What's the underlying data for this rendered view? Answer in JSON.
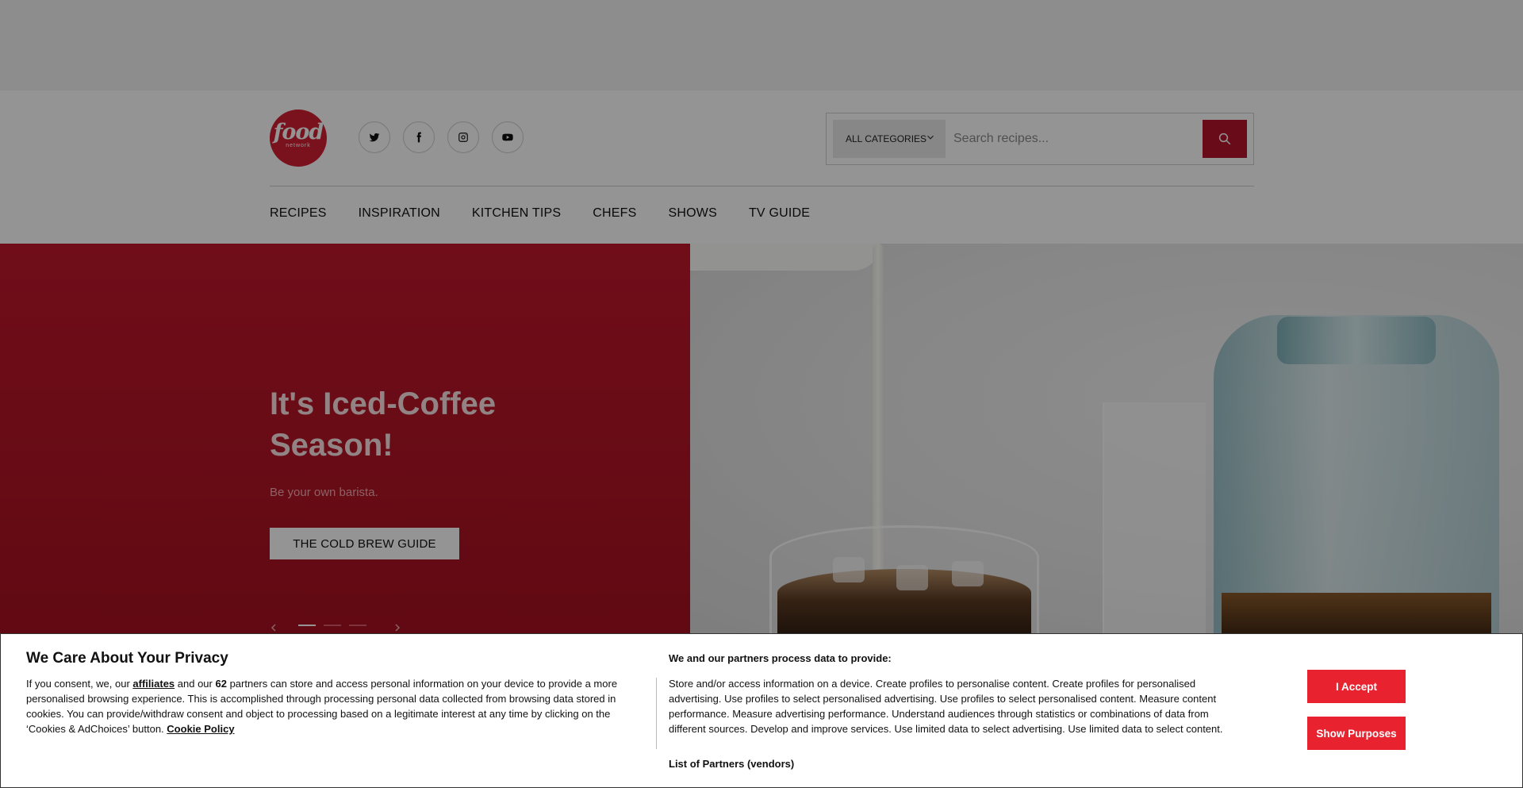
{
  "brand": {
    "logo_word": "food",
    "logo_sub": "network",
    "color": "#d01f33"
  },
  "social": [
    {
      "name": "twitter-icon"
    },
    {
      "name": "facebook-icon"
    },
    {
      "name": "instagram-icon"
    },
    {
      "name": "youtube-icon"
    }
  ],
  "search": {
    "category_label": "ALL CATEGORIES",
    "placeholder": "Search recipes...",
    "button_icon": "search-icon"
  },
  "nav": {
    "items": [
      {
        "label": "RECIPES"
      },
      {
        "label": "INSPIRATION"
      },
      {
        "label": "KITCHEN TIPS"
      },
      {
        "label": "CHEFS"
      },
      {
        "label": "SHOWS"
      },
      {
        "label": "TV GUIDE"
      }
    ]
  },
  "hero": {
    "title": "It's Iced-Coffee Season!",
    "subtitle": "Be your own barista.",
    "cta_label": "THE COLD BREW GUIDE",
    "slide_count": 3,
    "active_slide": 1
  },
  "consent": {
    "title": "We Care About Your Privacy",
    "body_prefix": "If you consent, we, our ",
    "affiliates_link": "affiliates",
    "body_mid": " and our ",
    "partner_count": "62",
    "body_rest": " partners can store and access personal information on your device to provide a more personalised browsing experience. This is accomplished through processing personal data collected from browsing data stored in cookies. You can provide/withdraw consent and object to processing based on a legitimate interest at any time by clicking on the ‘Cookies & AdChoices’ button. ",
    "cookie_policy_link": "Cookie Policy",
    "purposes_heading": "We and our partners process data to provide:",
    "purposes_text": "Store and/or access information on a device. Create profiles to personalise content. Create profiles for personalised advertising. Use profiles to select personalised advertising. Use profiles to select personalised content. Measure content performance. Measure advertising performance. Understand audiences through statistics or combinations of data from different sources. Develop and improve services. Use limited data to select advertising. Use limited data to select content.",
    "partners_link": "List of Partners (vendors)",
    "accept_label": "I Accept",
    "show_purposes_label": "Show Purposes",
    "button_color": "#e8222f"
  }
}
